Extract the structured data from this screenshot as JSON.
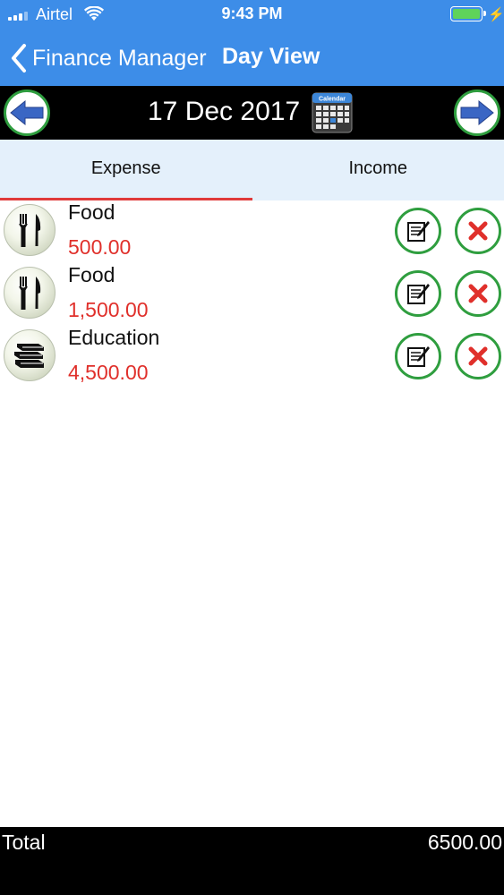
{
  "status_bar": {
    "carrier": "Airtel",
    "time": "9:43 PM",
    "battery_level": 1.0
  },
  "nav": {
    "back_label": "Finance Manager",
    "title": "Day View"
  },
  "date_bar": {
    "date": "17 Dec 2017",
    "calendar_label": "Calendar"
  },
  "tabs": [
    {
      "label": "Expense",
      "active": true
    },
    {
      "label": "Income",
      "active": false
    }
  ],
  "transactions": [
    {
      "category": "Food",
      "amount": "500.00",
      "icon": "fork-knife-icon"
    },
    {
      "category": "Food",
      "amount": "1,500.00",
      "icon": "fork-knife-icon"
    },
    {
      "category": "Education",
      "amount": "4,500.00",
      "icon": "books-icon"
    }
  ],
  "footer": {
    "total_label": "Total",
    "total_value": "6500.00"
  },
  "colors": {
    "nav_blue": "#3d8de8",
    "amount_red": "#e0302b",
    "button_green": "#2f9e3f",
    "arrow_blue": "#3a66c4",
    "tab_bg": "#e4f0fb",
    "tab_indicator": "#e03a3a"
  }
}
